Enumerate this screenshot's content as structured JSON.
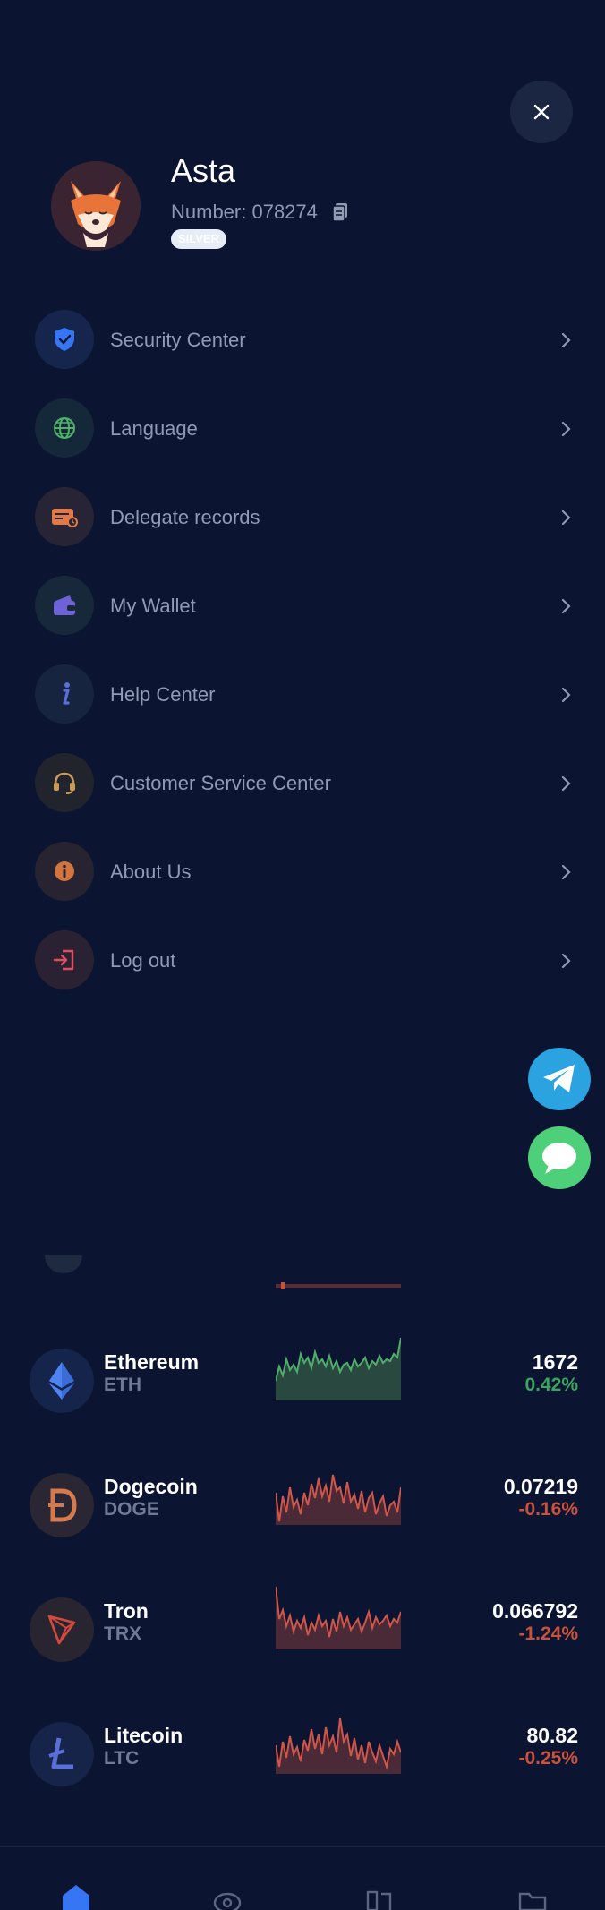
{
  "drawer": {
    "user": {
      "name": "Asta",
      "number_label": "Number: 078274",
      "level": "SILVER"
    },
    "menu": [
      {
        "label": "Security Center",
        "icon": "shield-icon"
      },
      {
        "label": "Language",
        "icon": "globe-icon"
      },
      {
        "label": "Delegate records",
        "icon": "records-icon"
      },
      {
        "label": "My Wallet",
        "icon": "wallet-icon"
      },
      {
        "label": "Help Center",
        "icon": "info-italic-icon"
      },
      {
        "label": "Customer Service Center",
        "icon": "headset-icon"
      },
      {
        "label": "About Us",
        "icon": "about-icon"
      },
      {
        "label": "Log out",
        "icon": "logout-icon"
      }
    ]
  },
  "floating": [
    {
      "icon": "telegram-icon",
      "color": "#2aa3e0"
    },
    {
      "icon": "chat-icon",
      "color": "#4ed07b"
    }
  ],
  "coins": [
    {
      "name": "Ethereum",
      "symbol": "ETH",
      "price": "1672",
      "change": "0.42%",
      "trend": "up",
      "icon": "ethereum-icon"
    },
    {
      "name": "Dogecoin",
      "symbol": "DOGE",
      "price": "0.07219",
      "change": "-0.16%",
      "trend": "down",
      "icon": "dogecoin-icon"
    },
    {
      "name": "Tron",
      "symbol": "TRX",
      "price": "0.066792",
      "change": "-1.24%",
      "trend": "down",
      "icon": "tron-icon"
    },
    {
      "name": "Litecoin",
      "symbol": "LTC",
      "price": "80.82",
      "change": "-0.25%",
      "trend": "down",
      "icon": "litecoin-icon"
    }
  ],
  "colors": {
    "background": "#0b1430",
    "up": "#3aa55e",
    "down": "#c9523f",
    "label": "#8f9ab3"
  },
  "tabbar": {
    "icons": [
      "home-icon",
      "market-icon",
      "trade-icon",
      "assets-icon"
    ]
  }
}
